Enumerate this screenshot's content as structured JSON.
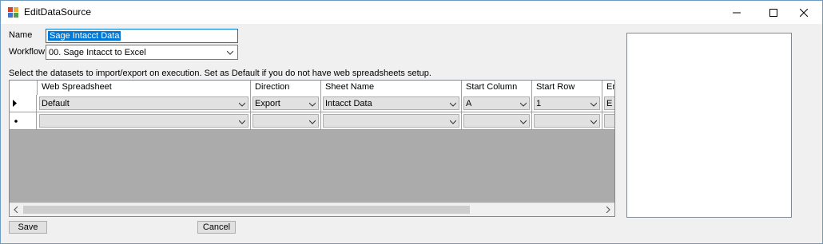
{
  "window": {
    "title": "EditDataSource"
  },
  "form": {
    "name_label": "Name",
    "name_value": "Sage Intacct Data",
    "workflow_label": "Workflow",
    "workflow_value": "00. Sage Intacct to Excel",
    "instructions": "Select the datasets to import/export on execution. Set as Default if you do not have web spreadsheets setup."
  },
  "grid": {
    "columns": [
      "Web Spreadsheet",
      "Direction",
      "Sheet Name",
      "Start Column",
      "Start Row",
      "En"
    ],
    "rows": [
      {
        "indicator": "current-row",
        "cells": [
          "Default",
          "Export",
          "Intacct Data",
          "A",
          "1",
          "E"
        ]
      },
      {
        "indicator": "new-row",
        "cells": [
          "",
          "",
          "",
          "",
          "",
          ""
        ]
      }
    ]
  },
  "buttons": {
    "save": "Save",
    "cancel": "Cancel"
  }
}
